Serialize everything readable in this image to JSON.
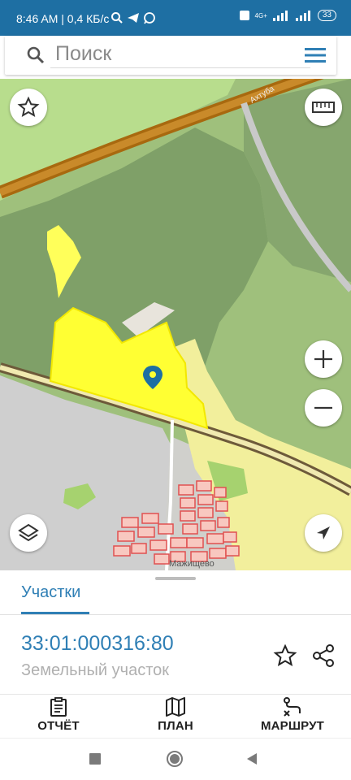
{
  "status_bar": {
    "time_speed": "8:46 AM | 0,4 КБ/с",
    "network_label": "4G+",
    "battery": "33"
  },
  "search": {
    "placeholder": "Поиск"
  },
  "map": {
    "road_label": "Ахтуба",
    "village_label": "Мажищево",
    "accent_color": "#2f7fb5",
    "highlight_color": "#ffff33"
  },
  "panel": {
    "tab": "Участки",
    "parcel_number": "33:01:000316:80",
    "parcel_type": "Земельный участок"
  },
  "bottom_nav": {
    "report": "ОТЧЁТ",
    "plan": "ПЛАН",
    "route": "МАРШРУТ"
  }
}
